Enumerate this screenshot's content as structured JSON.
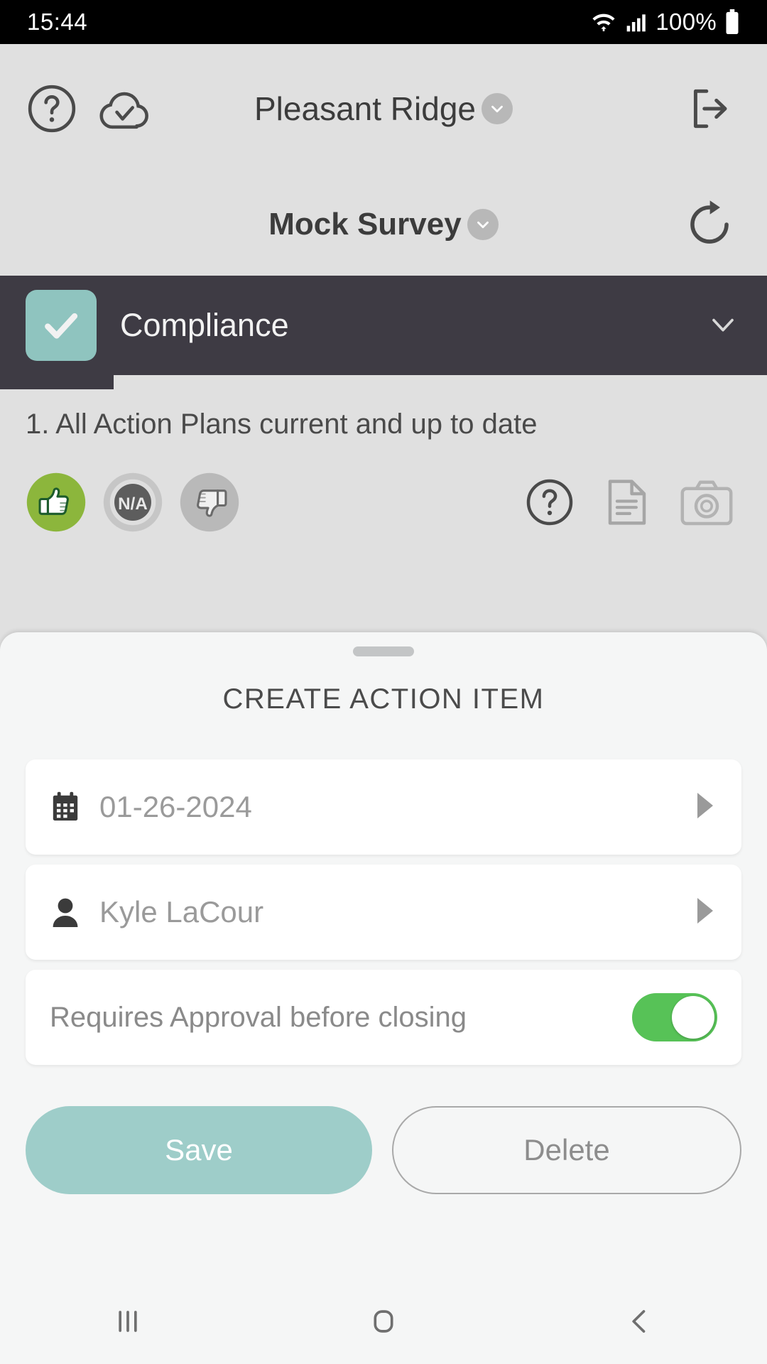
{
  "status_bar": {
    "time": "15:44",
    "battery_percent": "100%",
    "wifi_icon": "wifi-icon",
    "signal_icon": "cellular-signal-icon",
    "battery_icon": "battery-icon"
  },
  "header": {
    "help_icon": "help-circle-icon",
    "sync_icon": "cloud-check-icon",
    "site_name": "Pleasant Ridge",
    "site_dropdown_icon": "chevron-down-icon",
    "logout_icon": "logout-icon",
    "survey_name": "Mock Survey",
    "survey_dropdown_icon": "chevron-down-icon",
    "refresh_icon": "refresh-icon"
  },
  "section": {
    "label": "Compliance",
    "checked": true,
    "check_icon": "check-icon",
    "expand_icon": "chevron-down-icon",
    "bar_color": "#3e3b44",
    "check_color": "#8fc4bf"
  },
  "question": {
    "text": "1. All Action Plans current and up to date",
    "ratings": [
      {
        "name": "thumbs-up-icon",
        "label": "Yes",
        "selected": true,
        "color": "#8cb63c"
      },
      {
        "name": "na-icon",
        "label": "N/A",
        "selected": false,
        "color": "#b9b9b9"
      },
      {
        "name": "thumbs-down-icon",
        "label": "No",
        "selected": false,
        "color": "#b9b9b9"
      }
    ],
    "tools": [
      {
        "name": "help-circle-icon",
        "label": "Help"
      },
      {
        "name": "note-icon",
        "label": "Note"
      },
      {
        "name": "camera-icon",
        "label": "Photo"
      }
    ]
  },
  "sheet": {
    "title": "CREATE ACTION ITEM",
    "grabber": "drag-handle",
    "due_date": {
      "icon": "calendar-icon",
      "value": "01-26-2024",
      "arrow_icon": "arrow-right-icon"
    },
    "assignee": {
      "icon": "person-icon",
      "value": "Kyle LaCour",
      "arrow_icon": "arrow-right-icon"
    },
    "approval": {
      "label": "Requires Approval before closing",
      "toggle_on": true,
      "toggle_color": "#57c257"
    },
    "save_label": "Save",
    "delete_label": "Delete"
  },
  "navbar": {
    "recents_icon": "recents-icon",
    "home_icon": "home-icon",
    "back_icon": "back-icon"
  }
}
